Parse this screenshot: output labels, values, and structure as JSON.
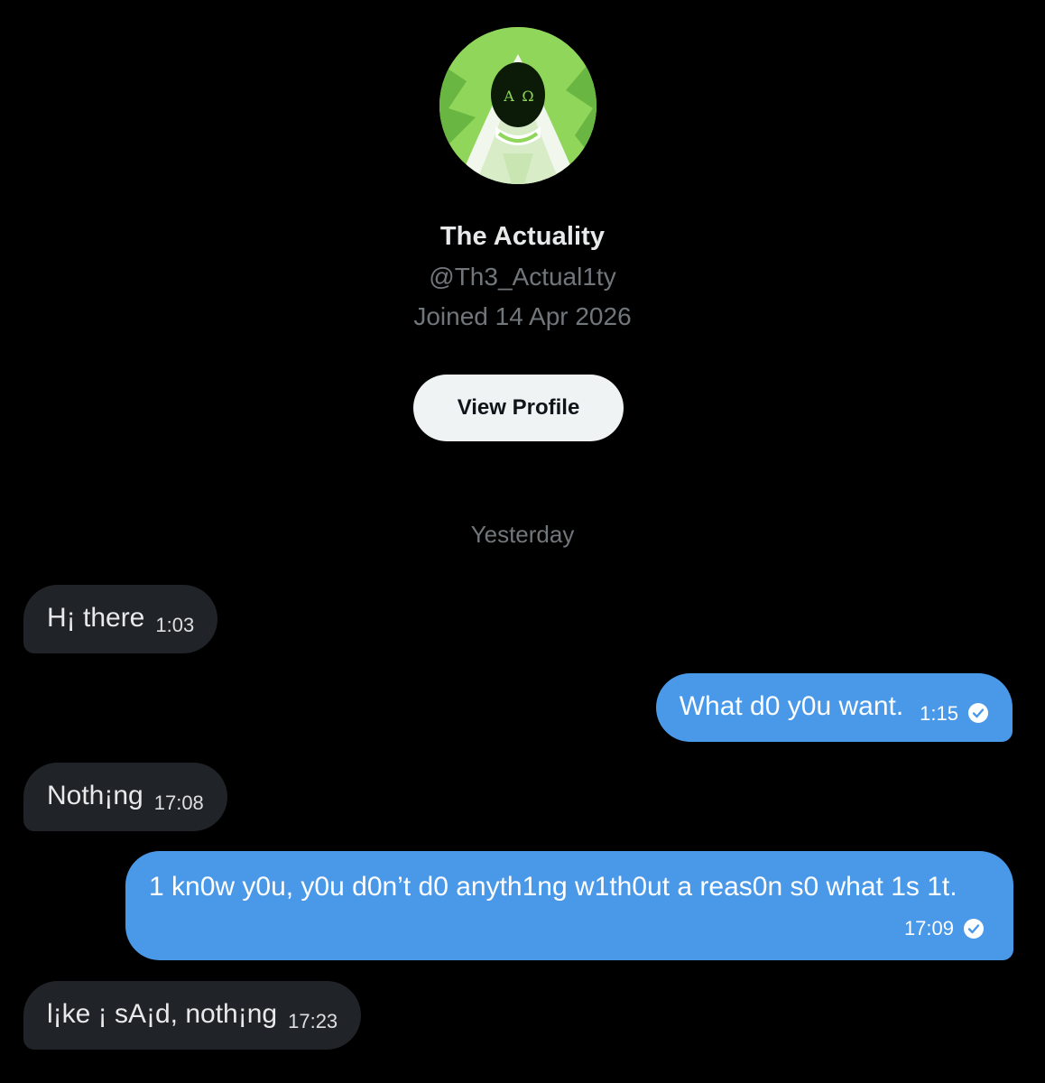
{
  "profile": {
    "avatar_icon": "hooded-figure-alpha-omega-avatar",
    "avatar_glyphs": "A Ω",
    "display_name": "The Actuality",
    "handle": "@Th3_Actual1ty",
    "joined": "Joined 14 Apr 2026",
    "view_profile_label": "View Profile"
  },
  "conversation": {
    "date_separator": "Yesterday",
    "messages": [
      {
        "direction": "received",
        "text": "H¡ there",
        "time": "1:03"
      },
      {
        "direction": "sent",
        "text": "What d0 y0u want.",
        "time": "1:15",
        "status_icon": "sent-check-icon"
      },
      {
        "direction": "received",
        "text": "Noth¡ng",
        "time": "17:08"
      },
      {
        "direction": "sent",
        "text": "1 kn0w y0u, y0u d0n’t d0 anyth1ng w1th0ut a reas0n s0 what 1s 1t.",
        "time": "17:09",
        "status_icon": "sent-check-icon"
      },
      {
        "direction": "received",
        "text": "l¡ke ¡ sA¡d, noth¡ng",
        "time": "17:23"
      }
    ]
  },
  "colors": {
    "background": "#000000",
    "received_bubble": "#202327",
    "sent_bubble": "#4a99e9",
    "secondary_text": "#71767b",
    "button_bg": "#eff3f4",
    "avatar_green": "#8fd65a"
  }
}
